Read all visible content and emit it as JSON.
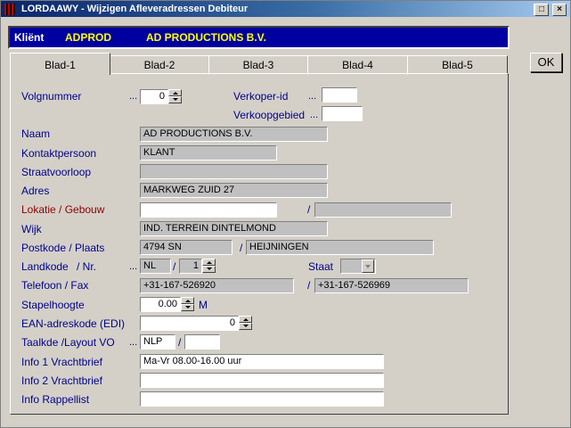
{
  "window": {
    "title": "LORDAAWY - Wijzigen Afleveradressen Debiteur",
    "minimize_glyph": "_",
    "maximize_glyph": "□",
    "close_glyph": "×"
  },
  "client": {
    "label": "Kliënt",
    "code": "ADPROD",
    "name": "AD PRODUCTIONS B.V."
  },
  "ok_label": "OK",
  "tabs": [
    "Blad-1",
    "Blad-2",
    "Blad-3",
    "Blad-4",
    "Blad-5"
  ],
  "active_tab": "Blad-1",
  "form": {
    "volgnummer": {
      "label": "Volgnummer",
      "dots": "...",
      "value": "0"
    },
    "verkoper_id": {
      "label": "Verkoper-id",
      "dots": "...",
      "value": ""
    },
    "verkoopgebied": {
      "label": "Verkoopgebied",
      "dots": "...",
      "value": ""
    },
    "naam": {
      "label": "Naam",
      "value": "AD PRODUCTIONS B.V."
    },
    "kontaktpersoon": {
      "label": "Kontaktpersoon",
      "value": "KLANT"
    },
    "straatvoorloop": {
      "label": "Straatvoorloop",
      "value": ""
    },
    "adres": {
      "label": "Adres",
      "value": "MARKWEG ZUID 27"
    },
    "lokatie": {
      "label": "Lokatie / Gebouw",
      "value": "",
      "value2": "",
      "slash": "/"
    },
    "wijk": {
      "label": "Wijk",
      "value": "IND. TERREIN DINTELMOND"
    },
    "postkode": {
      "label": "Postkode / Plaats",
      "postcode": "4794  SN",
      "plaats": "HEIJNINGEN",
      "slash": "/"
    },
    "landkode": {
      "label": "Landkode",
      "nr_label": "/ Nr.",
      "dots": "...",
      "value": "NL",
      "slash": "/",
      "nr": "1"
    },
    "staat": {
      "label": "Staat",
      "value": ""
    },
    "telefoon": {
      "label": "Telefoon / Fax",
      "value": "+31-167-526920",
      "fax": "+31-167-526969",
      "slash": "/"
    },
    "stapelhoogte": {
      "label": "Stapelhoogte",
      "value": "0.00",
      "unit": "M"
    },
    "ean": {
      "label": "EAN-adreskode (EDI)",
      "value": "0"
    },
    "taalkde": {
      "label": "Taalkde /Layout VO",
      "dots": "...",
      "value": "NLP",
      "layout": "",
      "slash": "/"
    },
    "info1": {
      "label": "Info 1 Vrachtbrief",
      "value": "Ma-Vr 08.00-16.00 uur"
    },
    "info2": {
      "label": "Info 2 Vrachtbrief",
      "value": ""
    },
    "info_rappel": {
      "label": "Info Rappellist",
      "value": ""
    }
  },
  "colors": {
    "title_bar": "#0a246a",
    "client_bar": "#0000a0",
    "client_text": "#ffff00",
    "label_text": "#00008b",
    "label_red": "#8b0000",
    "face": "#d4d0c8"
  }
}
